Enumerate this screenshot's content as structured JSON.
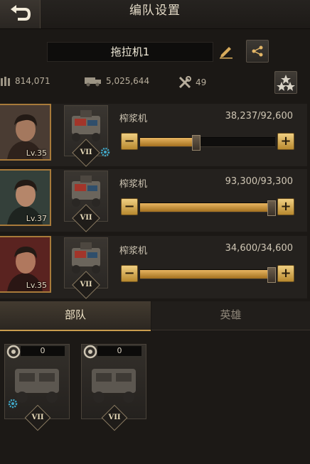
{
  "header": {
    "title": "编队设置"
  },
  "formation": {
    "name": "拖拉机1"
  },
  "stats": {
    "ammo": "814,071",
    "supply": "5,025,644",
    "tools": "49"
  },
  "rows": [
    {
      "hero_level": "Lv.35",
      "rank": "VII",
      "troop_name": "榨浆机",
      "count": "38,237/92,600",
      "ratio": 0.413,
      "has_gear": true
    },
    {
      "hero_level": "Lv.37",
      "rank": "VII",
      "troop_name": "榨浆机",
      "count": "93,300/93,300",
      "ratio": 1.0,
      "has_gear": false
    },
    {
      "hero_level": "Lv.35",
      "rank": "VII",
      "troop_name": "榨浆机",
      "count": "34,600/34,600",
      "ratio": 1.0,
      "has_gear": false
    }
  ],
  "tabs": [
    {
      "label": "部队",
      "active": true
    },
    {
      "label": "英雄",
      "active": false
    }
  ],
  "cards": [
    {
      "count": "0",
      "rank": "VII",
      "has_gear": true
    },
    {
      "count": "0",
      "rank": "VII",
      "has_gear": false
    }
  ],
  "buttons": {
    "minus": "−",
    "plus": "+"
  },
  "colors": {
    "accent": "#c99d4e",
    "fill": "#e8b561",
    "bg": "#1b1815"
  }
}
